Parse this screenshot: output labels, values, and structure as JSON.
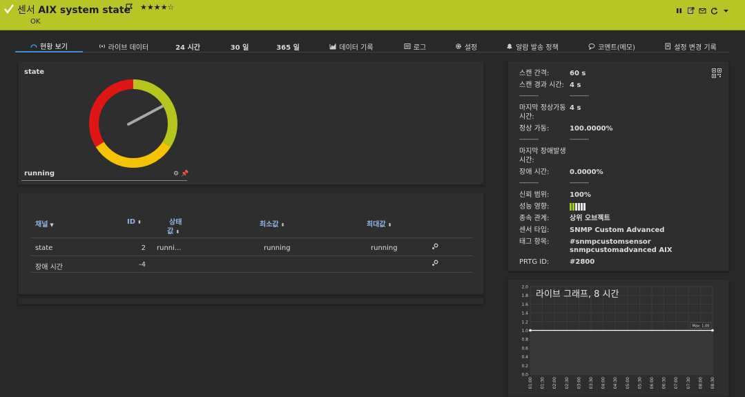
{
  "header": {
    "prefix": "센서",
    "name": "AIX system state",
    "stars": "★★★★☆",
    "status": "OK",
    "colors": {
      "bar": "#b8c526",
      "text": "#1d1d1d"
    }
  },
  "tabs": [
    {
      "label": "현황 보기",
      "icon": "overview-icon",
      "active": true
    },
    {
      "label": "라이브 데이터",
      "icon": "live-data-icon"
    },
    {
      "label": "24 시간",
      "icon": ""
    },
    {
      "label": "30 일",
      "icon": ""
    },
    {
      "label": "365 일",
      "icon": ""
    },
    {
      "label": "데이터 기록",
      "icon": "chart-icon"
    },
    {
      "label": "로그",
      "icon": "log-icon"
    },
    {
      "label": "설정",
      "icon": "gear-icon"
    },
    {
      "label": "알람 발송 정책",
      "icon": "bell-icon"
    },
    {
      "label": "코멘트(메모)",
      "icon": "comment-icon"
    },
    {
      "label": "설정 변경 기록",
      "icon": "history-icon"
    }
  ],
  "gauge": {
    "channel": "state",
    "value": "running",
    "colors": {
      "ok": "#b5c51e",
      "warning": "#f4c400",
      "error": "#e01616",
      "needle": "#a8a8a8"
    }
  },
  "table": {
    "headers": {
      "channel": "채널",
      "id": "ID",
      "state_1": "상태",
      "state_2": "값",
      "min": "최소값",
      "max": "최대값"
    },
    "rows": [
      {
        "channel": "state",
        "id": "2",
        "state": "runni...",
        "min": "running",
        "max": "running"
      },
      {
        "channel": "장애 시간",
        "id": "-4",
        "state": "",
        "min": "",
        "max": ""
      }
    ]
  },
  "info": {
    "scan_interval": {
      "key": "스캔 간격:",
      "value": "60 s"
    },
    "since_scan": {
      "key": "스캔 경과 시간:",
      "value": "4 s"
    },
    "last_up": {
      "key": "마지막 정상가동 시간:",
      "value": "4 s"
    },
    "uptime": {
      "key": "정상 가동:",
      "value": "100.0000%"
    },
    "last_down": {
      "key": "마지막 장애발생 시간:",
      "value": ""
    },
    "downtime": {
      "key": "장애 시간:",
      "value": "0.0000%"
    },
    "coverage": {
      "key": "신뢰 범위:",
      "value": "100%"
    },
    "performance": {
      "key": "성능 영향:",
      "value": "",
      "bars_filled": 2,
      "bars_total": 6
    },
    "dependency": {
      "key": "종속 관계:",
      "value": "상위 오브젝트"
    },
    "sensor_type": {
      "key": "센서 타입:",
      "value": "SNMP Custom Advanced"
    },
    "tags": {
      "key": "태그 항목:",
      "value_1": "#snmpcustomsensor",
      "value_2": "snmpcustomadvanced AIX"
    },
    "prtg_id": {
      "key": "PRTG ID:",
      "value": "#2800"
    },
    "dashes": "----------"
  },
  "chart_data": {
    "type": "line",
    "title": "라이브 그래프, 8 시간",
    "x": [
      "01:00",
      "01:30",
      "02:00",
      "02:30",
      "03:00",
      "03:30",
      "04:00",
      "04:30",
      "05:00",
      "05:30",
      "06:00",
      "06:30",
      "07:00",
      "07:30",
      "08:00",
      "08:30"
    ],
    "y_ticks": [
      "2.0",
      "1.8",
      "1.6",
      "1.4",
      "1.2",
      "1.0",
      "0.8",
      "0.6",
      "0.4",
      "0.2",
      "0.0"
    ],
    "ylim": [
      0,
      2
    ],
    "series": [
      {
        "values": [
          1,
          1,
          1,
          1,
          1,
          1,
          1,
          1,
          1,
          1,
          1,
          1,
          1,
          1,
          1,
          1
        ]
      }
    ],
    "annotation": "Max: 1.00",
    "grid": true,
    "colors": {
      "line": "#ffffff",
      "fill": "#3a3a3a"
    }
  }
}
